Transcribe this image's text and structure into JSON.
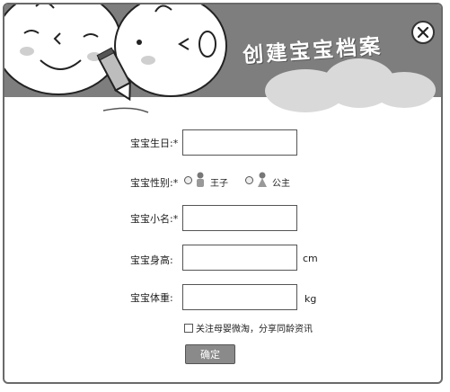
{
  "header": {
    "title": "创建宝宝档案"
  },
  "form": {
    "birthday": {
      "label": "宝宝生日:",
      "required": "*",
      "value": ""
    },
    "gender": {
      "label": "宝宝性别:",
      "required": "*",
      "options": [
        {
          "label": "王子"
        },
        {
          "label": "公主"
        }
      ]
    },
    "nickname": {
      "label": "宝宝小名:",
      "required": "*",
      "value": ""
    },
    "height": {
      "label": "宝宝身高:",
      "unit": "cm",
      "value": ""
    },
    "weight": {
      "label": "宝宝体重:",
      "unit": "kg",
      "value": ""
    },
    "follow": {
      "label": "关注母婴微淘，分享同龄资讯",
      "checked": false
    },
    "submit_label": "确定"
  },
  "colors": {
    "header_bg": "#7e7e7e",
    "button_bg": "#8a8a8a"
  }
}
